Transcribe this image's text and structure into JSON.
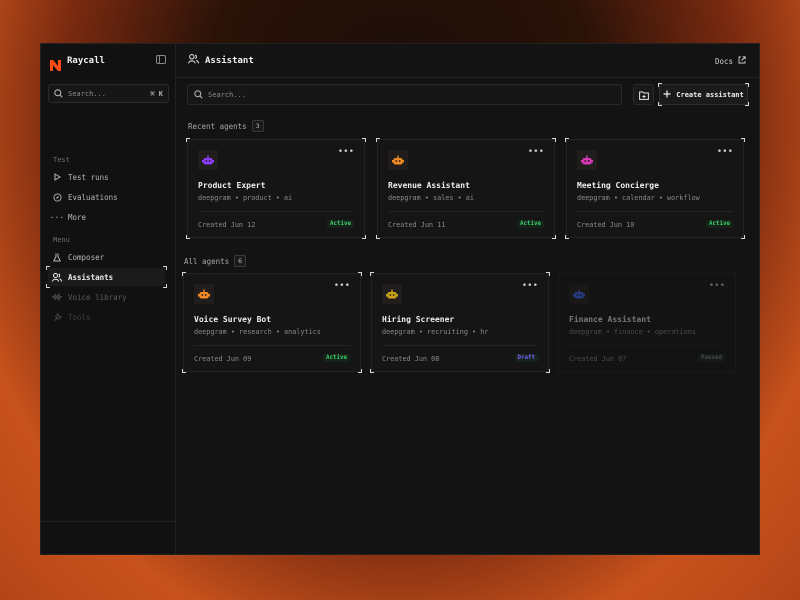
{
  "app": {
    "name": "Raycall",
    "brand_color": "#ff4d14"
  },
  "sidebar": {
    "search_placeholder": "Search...",
    "search_shortcut": "⌘ K",
    "sections": [
      {
        "label": "Test"
      },
      {
        "label": "Menu"
      }
    ],
    "test_items": [
      {
        "label": "Test runs",
        "icon": "play-icon"
      },
      {
        "label": "Evaluations",
        "icon": "compass-icon"
      },
      {
        "label": "More",
        "icon": "ellipsis-icon"
      }
    ],
    "menu_items": [
      {
        "label": "Composer",
        "icon": "flask-icon"
      },
      {
        "label": "Assistants",
        "icon": "users-icon",
        "active": true
      },
      {
        "label": "Voice library",
        "icon": "waveform-icon"
      },
      {
        "label": "Tools",
        "icon": "wrench-icon"
      }
    ]
  },
  "header": {
    "title": "Assistant",
    "docs_label": "Docs"
  },
  "main": {
    "search_placeholder": "Search...",
    "create_label": "Create assistant",
    "recent": {
      "label": "Recent agents",
      "count": "3",
      "cards": [
        {
          "name": "Product Expert",
          "tags": "deepgram • product • ai",
          "created": "Created Jun 12",
          "status": "Active",
          "icon_color": "#8b3dff"
        },
        {
          "name": "Revenue Assistant",
          "tags": "deepgram • sales • ai",
          "created": "Created Jun 11",
          "status": "Active",
          "icon_color": "#f08a24"
        },
        {
          "name": "Meeting Concierge",
          "tags": "deepgram • calendar • workflow",
          "created": "Created Jun 10",
          "status": "Active",
          "icon_color": "#d63ab8"
        }
      ]
    },
    "all": {
      "label": "All agents",
      "count": "6",
      "cards": [
        {
          "name": "Voice Survey Bot",
          "tags": "deepgram • research • analytics",
          "created": "Created Jun 09",
          "status": "Active",
          "icon_color": "#f08a24"
        },
        {
          "name": "Hiring Screener",
          "tags": "deepgram • recruiting • hr",
          "created": "Created Jun 08",
          "status": "Draft",
          "icon_color": "#c9a21a"
        },
        {
          "name": "Finance Assistant",
          "tags": "deepgram • finance • operations",
          "created": "Created Jun 07",
          "status": "Paused",
          "icon_color": "#3b6cff"
        }
      ]
    }
  },
  "colors": {
    "active": "#3ad06a",
    "draft": "#7a5cff",
    "paused": "#8a8888"
  }
}
